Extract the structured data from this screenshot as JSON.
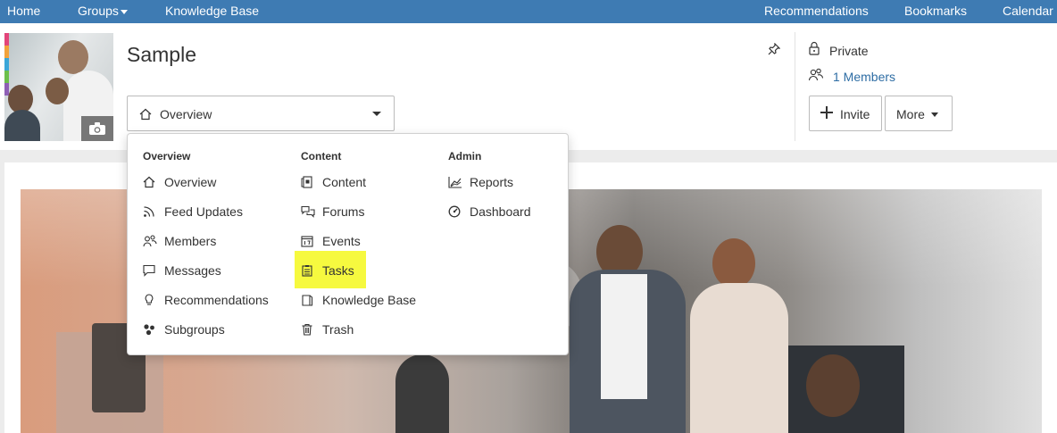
{
  "topnav": {
    "left": [
      {
        "label": "Home"
      },
      {
        "label": "Groups"
      },
      {
        "label": "Knowledge Base"
      }
    ],
    "right": [
      {
        "label": "Recommendations"
      },
      {
        "label": "Bookmarks"
      },
      {
        "label": "Calendar"
      }
    ]
  },
  "group": {
    "title": "Sample",
    "privacy": "Private",
    "members": "1 Members"
  },
  "selector": {
    "value": "Overview"
  },
  "buttons": {
    "invite": "Invite",
    "more": "More"
  },
  "menu": {
    "columns": [
      {
        "heading": "Overview",
        "items": [
          {
            "label": "Overview",
            "icon": "home-icon"
          },
          {
            "label": "Feed Updates",
            "icon": "rss-icon"
          },
          {
            "label": "Members",
            "icon": "members-icon"
          },
          {
            "label": "Messages",
            "icon": "message-icon"
          },
          {
            "label": "Recommendations",
            "icon": "lightbulb-icon"
          },
          {
            "label": "Subgroups",
            "icon": "subgroups-icon"
          }
        ]
      },
      {
        "heading": "Content",
        "items": [
          {
            "label": "Content",
            "icon": "content-icon"
          },
          {
            "label": "Forums",
            "icon": "forums-icon"
          },
          {
            "label": "Events",
            "icon": "calendar-icon"
          },
          {
            "label": "Tasks",
            "icon": "tasks-icon",
            "highlighted": true
          },
          {
            "label": "Knowledge Base",
            "icon": "book-icon"
          },
          {
            "label": "Trash",
            "icon": "trash-icon"
          }
        ]
      },
      {
        "heading": "Admin",
        "items": [
          {
            "label": "Reports",
            "icon": "reports-icon"
          },
          {
            "label": "Dashboard",
            "icon": "dashboard-icon"
          }
        ]
      }
    ]
  },
  "colors": {
    "nav_bg": "#3e7bb3",
    "link": "#2e6da4",
    "highlight": "#f6f93f"
  }
}
